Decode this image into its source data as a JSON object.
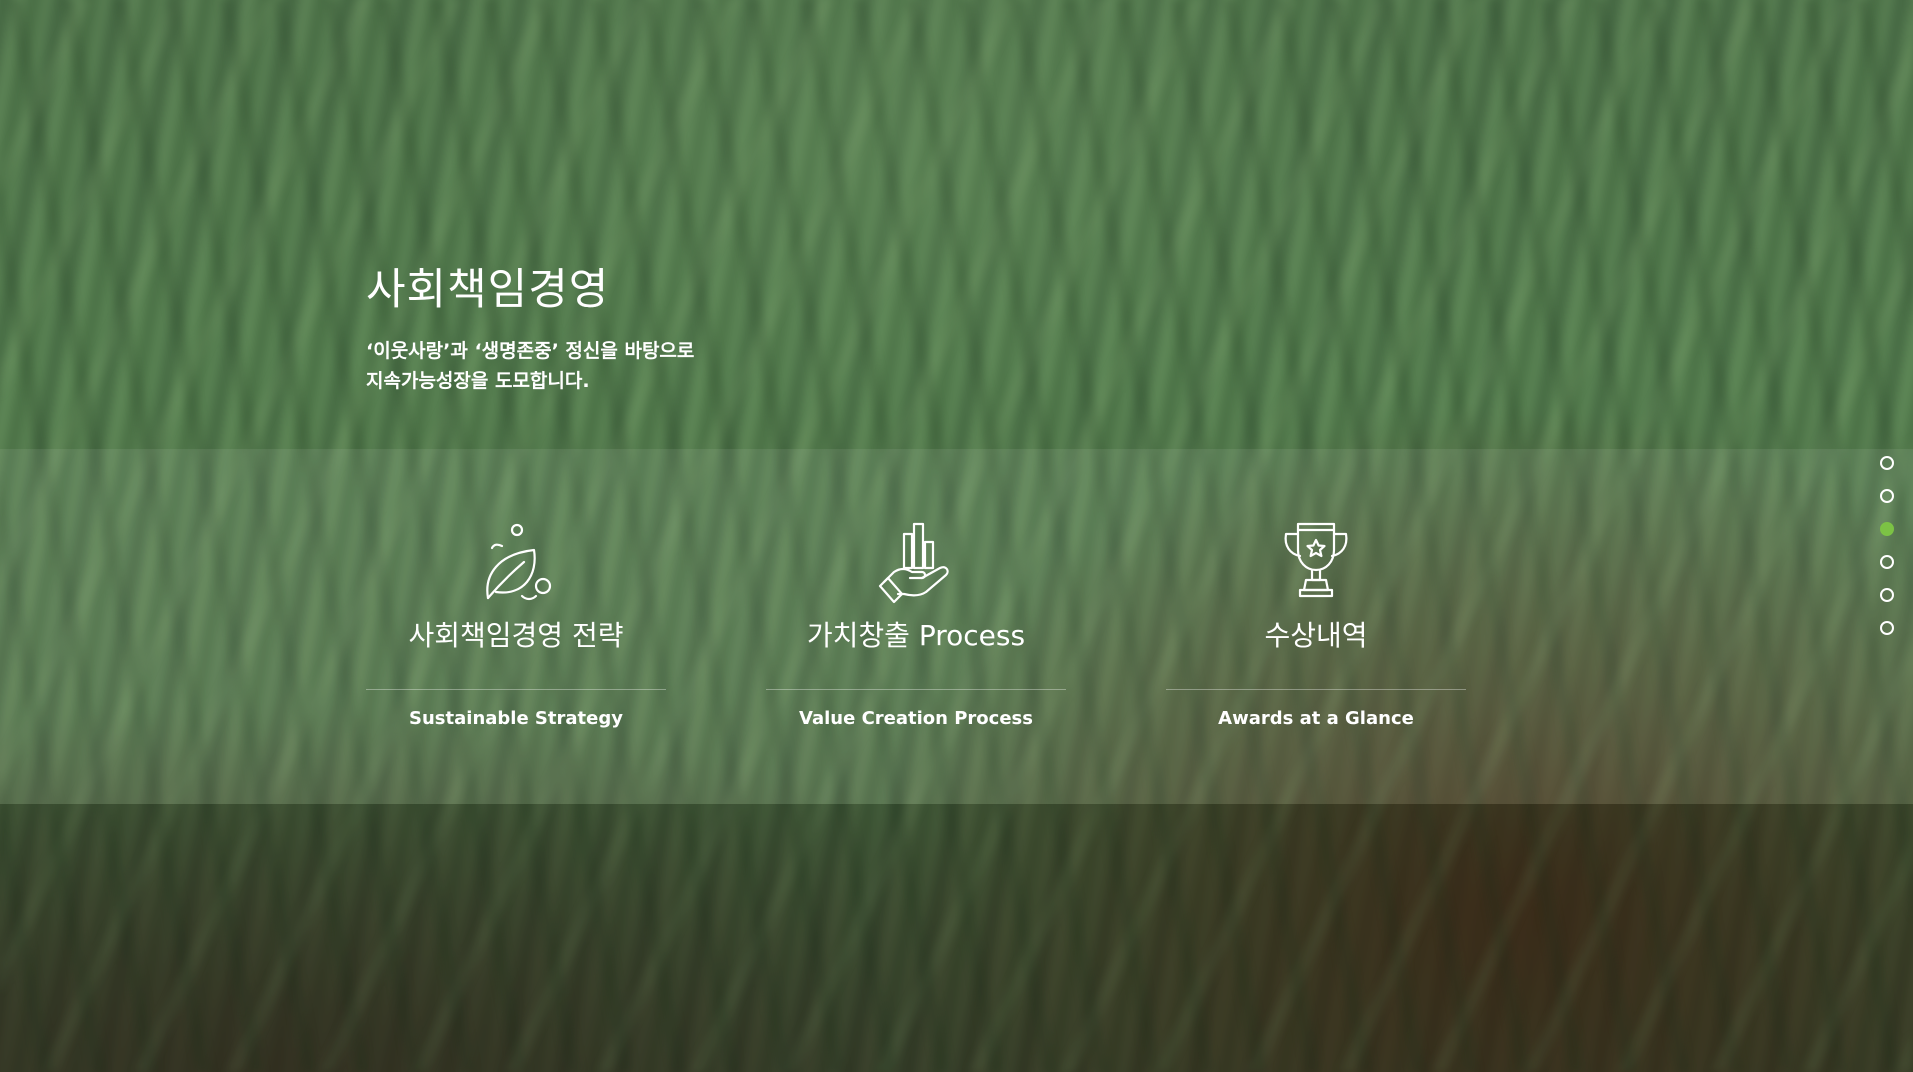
{
  "hero": {
    "title": "사회책임경영",
    "desc_line1": "‘이웃사랑’과 ‘생명존중’ 정신을 바탕으로",
    "desc_line2": "지속가능성장을 도모합니다."
  },
  "cards": [
    {
      "title": "사회책임경영 전략",
      "subtitle": "Sustainable Strategy",
      "icon": "leaf-icon"
    },
    {
      "title": "가치창출 Process",
      "subtitle": "Value Creation Process",
      "icon": "hand-growth-icon"
    },
    {
      "title": "수상내역",
      "subtitle": "Awards at a Glance",
      "icon": "trophy-icon"
    }
  ],
  "pagination": {
    "count": 6,
    "active_index": 2
  },
  "colors": {
    "accent": "#7cc245",
    "text": "#ffffff"
  }
}
